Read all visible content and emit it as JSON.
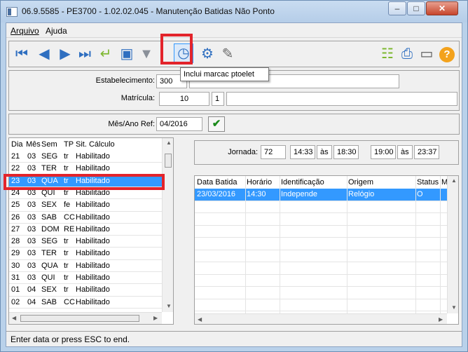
{
  "window": {
    "title": "06.9.5585 - PE3700 - 1.02.02.045 - Manutenção Batidas Não Ponto"
  },
  "menu": {
    "items": [
      {
        "label": "Arquivo"
      },
      {
        "label": "Ajuda"
      }
    ]
  },
  "toolbar": {
    "tooltip": "Inclui marcac ptoelet",
    "buttons": [
      "first-icon",
      "previous-icon",
      "next-icon",
      "last-icon",
      "return-icon",
      "zoom-icon",
      "filter-icon",
      "clock-icon",
      "execute-icon",
      "edit-icon",
      "tree-icon",
      "print-icon",
      "exit-icon",
      "help-icon"
    ]
  },
  "form": {
    "estabelecimento_label": "Estabelecimento:",
    "estabelecimento_value": "300",
    "matricula_label": "Matrícula:",
    "matricula_value": "10",
    "matricula_digit": "1",
    "mesano_label": "Mês/Ano Ref:",
    "mesano_value": "04/2016"
  },
  "days": {
    "headers": [
      "Dia",
      "Mês",
      "Sem",
      "TP",
      "Sit. Cálculo"
    ],
    "rows": [
      [
        "21",
        "03",
        "SEG",
        "tr",
        "Habilitado"
      ],
      [
        "22",
        "03",
        "TER",
        "tr",
        "Habilitado"
      ],
      [
        "23",
        "03",
        "QUA",
        "tr",
        "Habilitado"
      ],
      [
        "24",
        "03",
        "QUI",
        "tr",
        "Habilitado"
      ],
      [
        "25",
        "03",
        "SEX",
        "fe",
        "Habilitado"
      ],
      [
        "26",
        "03",
        "SAB",
        "CC",
        "Habilitado"
      ],
      [
        "27",
        "03",
        "DOM",
        "RE",
        "Habilitado"
      ],
      [
        "28",
        "03",
        "SEG",
        "tr",
        "Habilitado"
      ],
      [
        "29",
        "03",
        "TER",
        "tr",
        "Habilitado"
      ],
      [
        "30",
        "03",
        "QUA",
        "tr",
        "Habilitado"
      ],
      [
        "31",
        "03",
        "QUI",
        "tr",
        "Habilitado"
      ],
      [
        "01",
        "04",
        "SEX",
        "tr",
        "Habilitado"
      ],
      [
        "02",
        "04",
        "SAB",
        "CC",
        "Habilitado"
      ]
    ],
    "selected_index": 2
  },
  "jornada": {
    "label": "Jornada:",
    "code": "72",
    "t1": "14:33",
    "as1": "às",
    "t2": "18:30",
    "t3": "19:00",
    "as2": "às",
    "t4": "23:37"
  },
  "batidas": {
    "headers": [
      "Data Batida",
      "Horário",
      "Identificação",
      "Origem",
      "Status",
      "M"
    ],
    "rows": [
      [
        "23/03/2016",
        "14:30",
        "Independe",
        "Relógio",
        "O",
        ""
      ]
    ]
  },
  "status": {
    "text": "Enter data or press ESC to end."
  },
  "colors": {
    "selection": "#3399ff",
    "highlight": "#e3242b"
  }
}
